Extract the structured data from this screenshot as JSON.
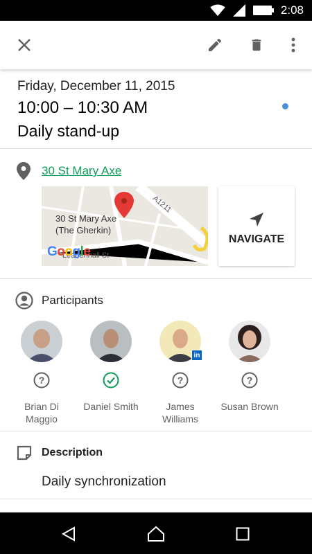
{
  "status_bar": {
    "time": "2:08"
  },
  "event": {
    "date": "Friday, December 11, 2015",
    "time_range": "10:00 – 10:30 AM",
    "title": "Daily stand-up",
    "calendar_color": "#4a90d9"
  },
  "location": {
    "address": "30 St Mary Axe",
    "map_label_line1": "30 St Mary Axe",
    "map_label_line2": "(The Gherkin)",
    "map_road_a": "A1211",
    "map_road_b": "Leadenhall St",
    "map_provider": "Google",
    "navigate_label": "NAVIGATE"
  },
  "participants": {
    "title": "Participants",
    "people": [
      {
        "name_line1": "Brian Di",
        "name_line2": "Maggio",
        "status": "unknown"
      },
      {
        "name_line1": "Daniel Smith",
        "name_line2": "",
        "status": "accepted"
      },
      {
        "name_line1": "James",
        "name_line2": "Williams",
        "status": "unknown",
        "badge": "in"
      },
      {
        "name_line1": "Susan Brown",
        "name_line2": "",
        "status": "unknown"
      }
    ]
  },
  "description": {
    "title": "Description",
    "text": "Daily synchronization"
  },
  "colors": {
    "link": "#0f9d58",
    "accepted": "#0f9d58",
    "icon_grey": "#616161"
  }
}
